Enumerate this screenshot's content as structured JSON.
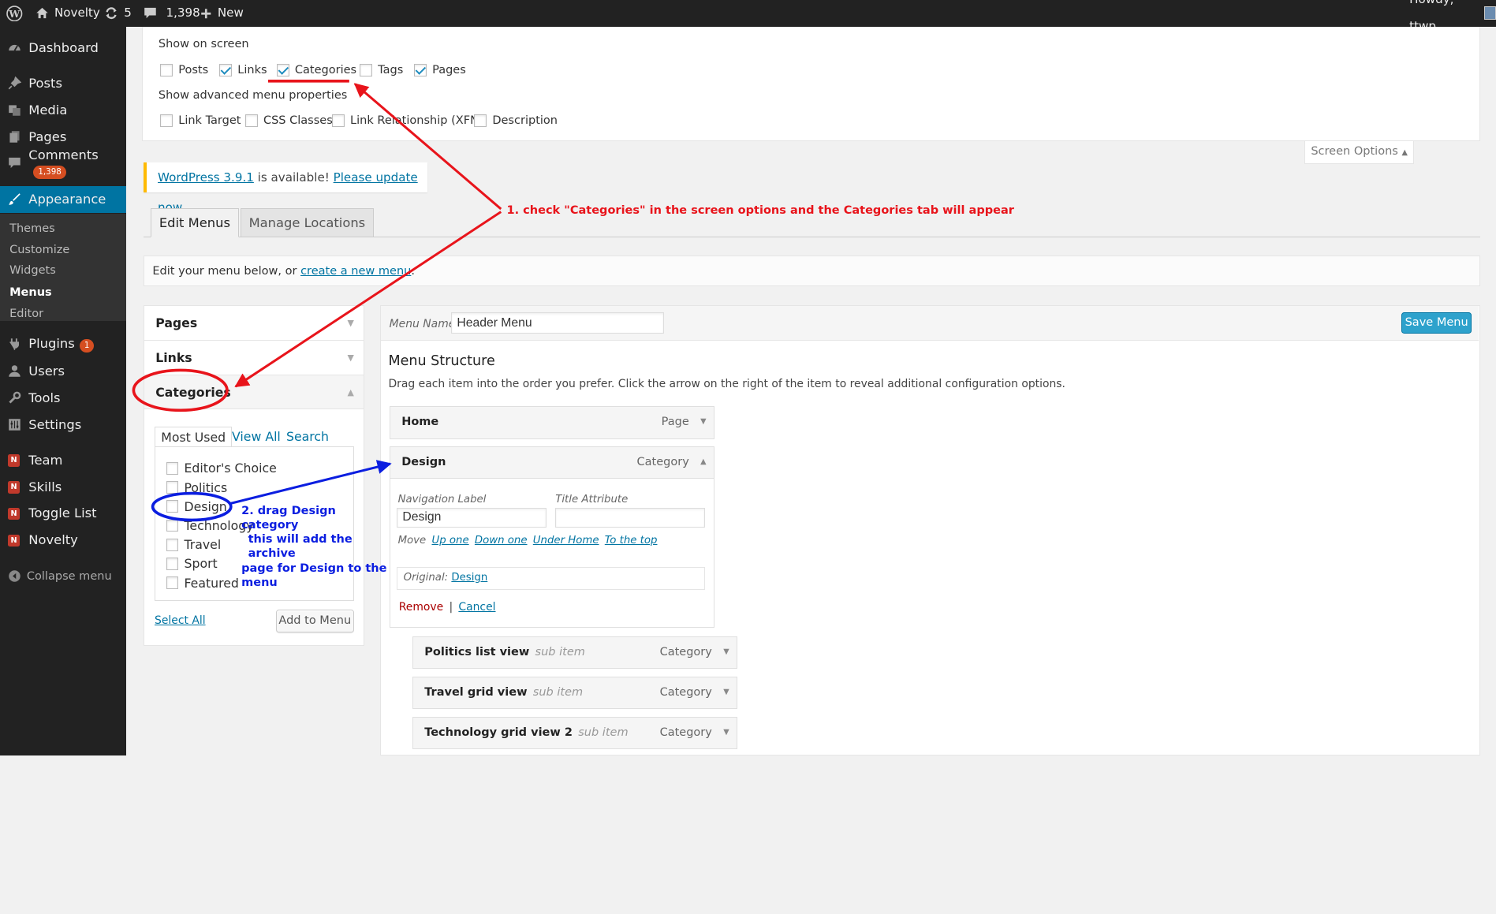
{
  "admin_bar": {
    "site_name": "Novelty",
    "updates_count": "5",
    "comments_count": "1,398",
    "new_label": "New",
    "howdy": "Howdy, ttwp"
  },
  "sidebar": {
    "dashboard": "Dashboard",
    "posts": "Posts",
    "media": "Media",
    "pages": "Pages",
    "comments": "Comments",
    "comments_badge": "1,398",
    "appearance": "Appearance",
    "appearance_sub": [
      "Themes",
      "Customize",
      "Widgets",
      "Menus",
      "Editor"
    ],
    "plugins": "Plugins",
    "plugins_badge": "1",
    "users": "Users",
    "tools": "Tools",
    "settings": "Settings",
    "team": "Team",
    "skills": "Skills",
    "toggle_list": "Toggle List",
    "novelty": "Novelty",
    "collapse": "Collapse menu"
  },
  "screen_options": {
    "show_on_screen": "Show on screen",
    "boxes": [
      {
        "label": "Posts",
        "checked": false
      },
      {
        "label": "Links",
        "checked": true
      },
      {
        "label": "Categories",
        "checked": true
      },
      {
        "label": "Tags",
        "checked": false
      },
      {
        "label": "Pages",
        "checked": true
      }
    ],
    "advanced_heading": "Show advanced menu properties",
    "advanced": [
      "Link Target",
      "CSS Classes",
      "Link Relationship (XFN)",
      "Description"
    ],
    "tab_label": "Screen Options"
  },
  "notice": {
    "link1": "WordPress 3.9.1",
    "middle": " is available! ",
    "link2": "Please update now",
    "end": "."
  },
  "tabs": {
    "edit": "Edit Menus",
    "manage": "Manage Locations"
  },
  "edit_bar": {
    "text": "Edit your menu below, or ",
    "link": "create a new menu",
    "end": "."
  },
  "left_panel": {
    "pages": "Pages",
    "links": "Links",
    "categories": "Categories",
    "cat_tabs": [
      "Most Used",
      "View All",
      "Search"
    ],
    "cat_items": [
      "Editor's Choice",
      "Politics",
      "Design",
      "Technology",
      "Travel",
      "Sport",
      "Featured"
    ],
    "select_all": "Select All",
    "add_to_menu": "Add to Menu"
  },
  "menu": {
    "name_label": "Menu Name",
    "name_value": "Header Menu",
    "save": "Save Menu",
    "structure_title": "Menu Structure",
    "structure_desc": "Drag each item into the order you prefer. Click the arrow on the right of the item to reveal additional configuration options.",
    "home": {
      "title": "Home",
      "type": "Page"
    },
    "design": {
      "title": "Design",
      "type": "Category"
    },
    "nav_label": "Navigation Label",
    "nav_value": "Design",
    "title_attr": "Title Attribute",
    "move": "Move",
    "move_links": [
      "Up one",
      "Down one",
      "Under Home",
      "To the top"
    ],
    "original_label": "Original:",
    "original_link": "Design",
    "remove": "Remove",
    "sep": "|",
    "cancel": "Cancel",
    "subitems": [
      {
        "title": "Politics list view",
        "sub": "sub item",
        "type": "Category"
      },
      {
        "title": "Travel grid view",
        "sub": "sub item",
        "type": "Category"
      },
      {
        "title": "Technology grid view 2",
        "sub": "sub item",
        "type": "Category"
      }
    ]
  },
  "annotations": {
    "step1": "1. check \"Categories\" in the screen options and the Categories tab will appear",
    "step2_lines": [
      "2. drag Design category",
      "this will add the archive",
      "page for Design to the menu"
    ],
    "step1_color": "#e8141b",
    "step2_color": "#0b1ee0"
  },
  "colors": {
    "admin_bg": "#222222",
    "accent": "#0074a2",
    "save_button": "#2ea2cc",
    "badge": "#d54e21"
  }
}
